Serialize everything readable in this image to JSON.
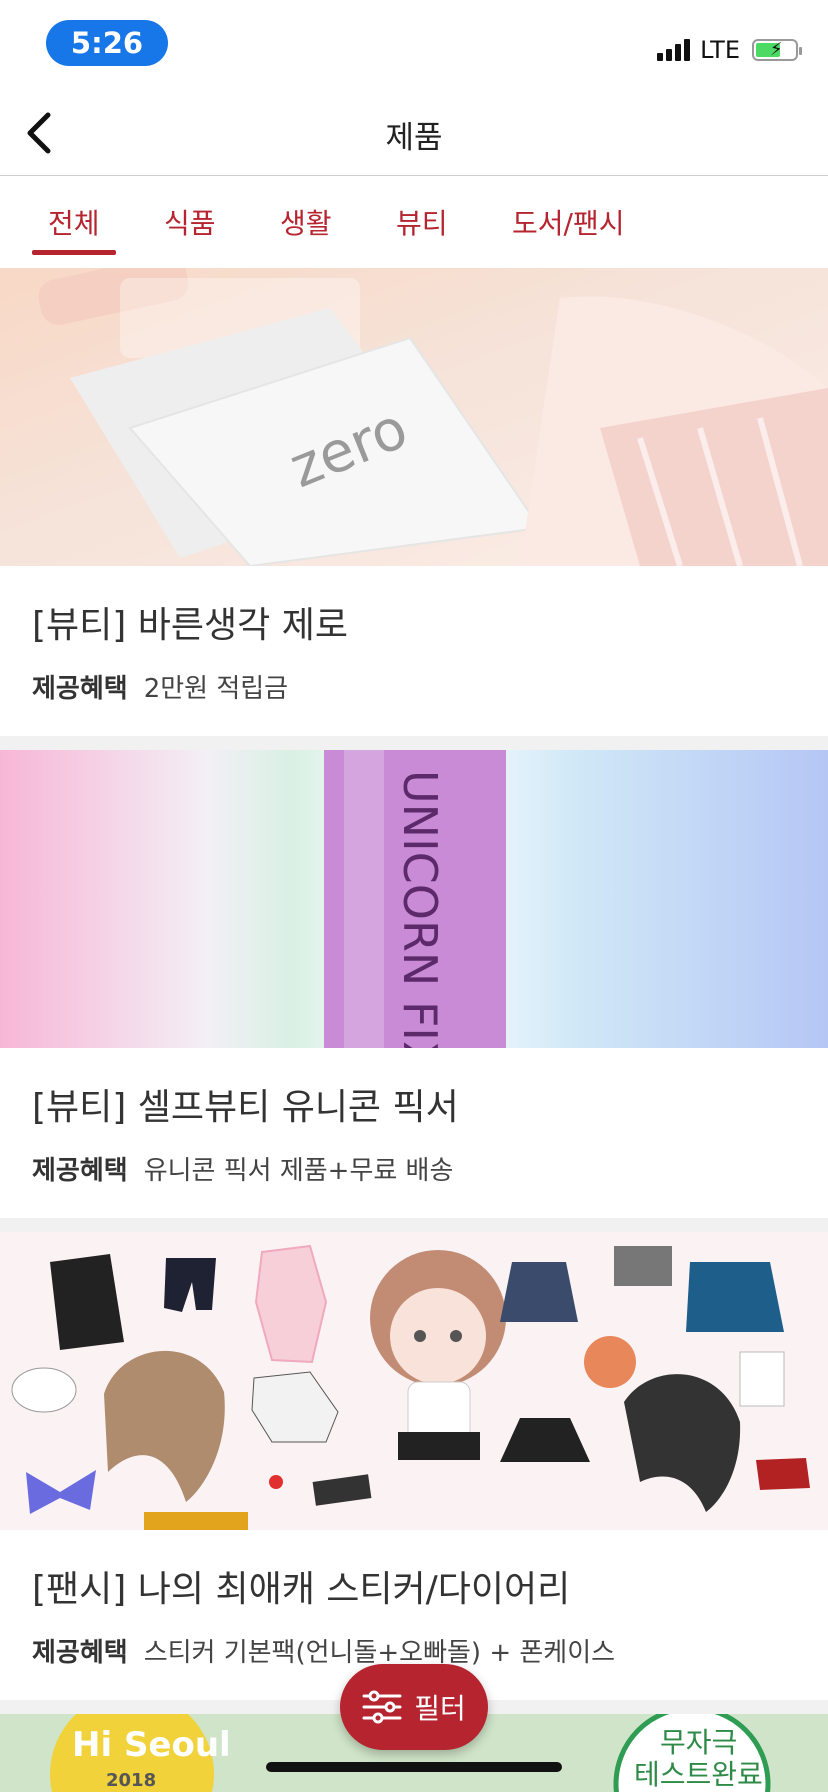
{
  "status_bar": {
    "time": "5:26",
    "network": "LTE"
  },
  "header": {
    "title": "제품"
  },
  "tabs": [
    {
      "label": "전체",
      "active": true
    },
    {
      "label": "식품",
      "active": false
    },
    {
      "label": "생활",
      "active": false
    },
    {
      "label": "뷰티",
      "active": false
    },
    {
      "label": "도서/팬시",
      "active": false
    }
  ],
  "products": [
    {
      "title": "[뷰티] 바른생각 제로",
      "benefit_label": "제공혜택",
      "benefit": "2만원 적립금",
      "image_text": "zero"
    },
    {
      "title": "[뷰티] 셀프뷰티 유니콘 픽서",
      "benefit_label": "제공혜택",
      "benefit": "유니콘 픽서 제품+무료 배송",
      "image_text": "UNICORN FIXER"
    },
    {
      "title": "[팬시] 나의 최애캐 스티커/다이어리",
      "benefit_label": "제공혜택",
      "benefit": "스티커 기본팩(언니돌+오빠돌) + 폰케이스"
    }
  ],
  "partial_card": {
    "left_text": "Hi Seoul",
    "left_year": "2018",
    "right_text_1": "무자극",
    "right_text_2": "테스트완료"
  },
  "filter_button": {
    "label": "필터"
  },
  "colors": {
    "accent": "#b5242f",
    "time_pill": "#1877e8"
  }
}
